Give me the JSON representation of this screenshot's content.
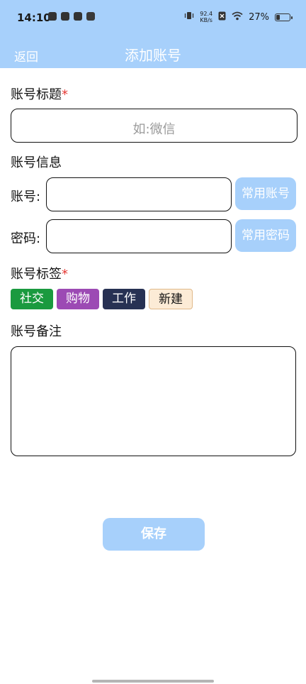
{
  "status_bar": {
    "time": "14:10",
    "net_speed_value": "92.4",
    "net_speed_unit": "KB/s",
    "battery_percent": "27%",
    "battery_level": 0.27
  },
  "header": {
    "back_label": "返回",
    "title": "添加账号"
  },
  "form": {
    "title_label": "账号标题",
    "required_mark": "*",
    "title_placeholder": "如:微信",
    "title_value": "",
    "info_label": "账号信息",
    "account_label": "账号:",
    "account_value": "",
    "common_account_button": "常用账号",
    "password_label": "密码:",
    "password_value": "",
    "common_password_button": "常用密码",
    "tags_label": "账号标签",
    "tags": [
      {
        "label": "社交",
        "color": "#1a9a3f"
      },
      {
        "label": "购物",
        "color": "#9c4ab4"
      },
      {
        "label": "工作",
        "color": "#273153"
      },
      {
        "label": "新建",
        "color": "#fcebd6"
      }
    ],
    "notes_label": "账号备注",
    "notes_value": "",
    "save_button": "保存"
  },
  "colors": {
    "header_bg": "#a7d0fb",
    "accent": "#a7d0fb",
    "required": "#e53935"
  }
}
